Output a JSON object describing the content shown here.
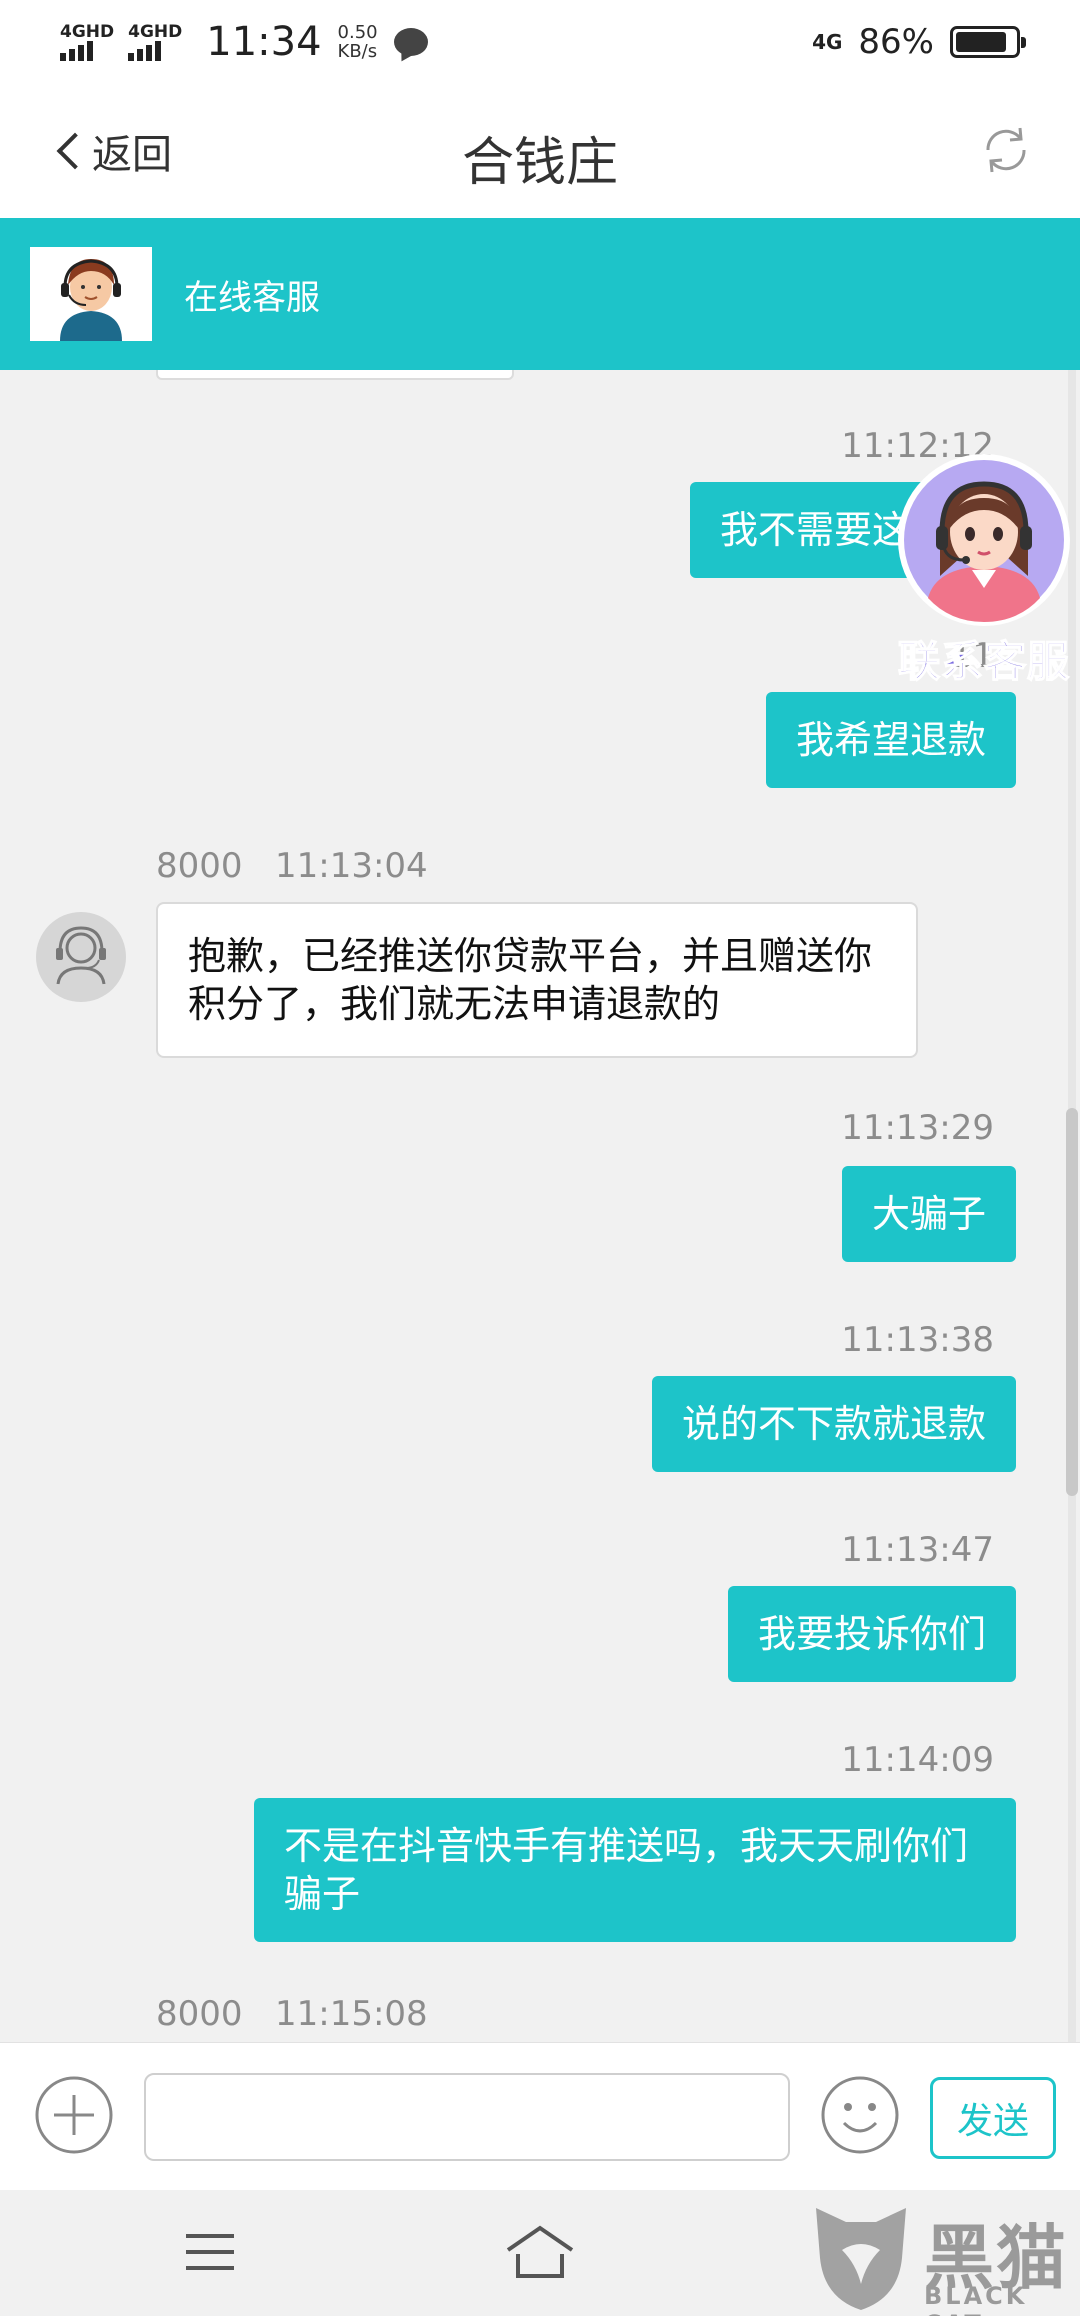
{
  "status_bar": {
    "sim1_label": "4GHD",
    "sim2_label": "4GHD",
    "time": "11:34",
    "speed_value": "0.50",
    "speed_unit": "KB/s",
    "network_label": "4G",
    "battery_percent": "86%",
    "battery_level": 0.86,
    "icons": [
      "signal-icon",
      "signal-icon",
      "message-bubble-icon",
      "battery-icon"
    ]
  },
  "header": {
    "back_label": "返回",
    "title": "合钱庄",
    "refresh_icon": "refresh-icon"
  },
  "banner": {
    "title": "在线客服",
    "avatar_icon": "customer-service-avatar"
  },
  "messages": [
    {
      "side": "right",
      "time": "11:12:12",
      "text": "我不需要这些，"
    },
    {
      "side": "right",
      "time": "11",
      "text": "我希望退款"
    },
    {
      "side": "left",
      "sender": "8000",
      "time": "11:13:04",
      "text": "抱歉，已经推送你贷款平台，并且赠送你积分了，我们就无法申请退款的"
    },
    {
      "side": "right",
      "time": "11:13:29",
      "text": "大骗子"
    },
    {
      "side": "right",
      "time": "11:13:38",
      "text": "说的不下款就退款"
    },
    {
      "side": "right",
      "time": "11:13:47",
      "text": "我要投诉你们"
    },
    {
      "side": "right",
      "time": "11:14:09",
      "text": "不是在抖音快手有推送吗，我天天刷你们骗子"
    },
    {
      "side": "left",
      "sender": "8000",
      "time": "11:15:08",
      "text": ""
    }
  ],
  "floating_widget": {
    "label": "联系客服",
    "icon": "headset-agent-icon"
  },
  "input_bar": {
    "input_value": "",
    "placeholder": "",
    "send_label": "发送",
    "icons": [
      "plus-circle-icon",
      "smiley-icon"
    ]
  },
  "system_nav": {
    "icons": [
      "menu-icon",
      "home-icon"
    ]
  },
  "watermark": {
    "text_cn": "黑猫",
    "text_en": "BLACK CAT"
  },
  "colors": {
    "accent": "#1dc4c9",
    "background": "#f1f1f1",
    "timestamp": "#8c8c8c",
    "widget_label": "#7a6be0"
  }
}
